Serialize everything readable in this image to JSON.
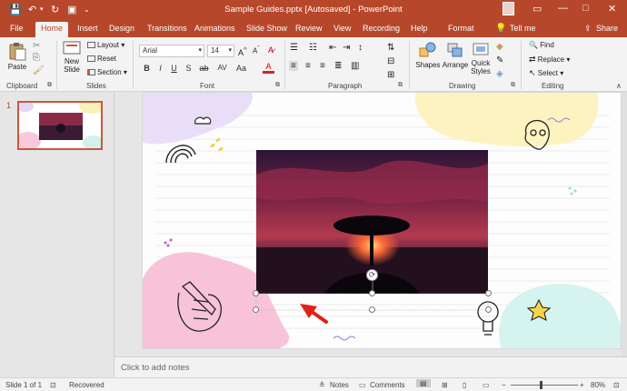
{
  "window": {
    "title": "Sample Guides.pptx [Autosaved] - PowerPoint",
    "account": "",
    "controls": [
      "—",
      "□",
      "✕"
    ]
  },
  "tabs": [
    {
      "label": "File"
    },
    {
      "label": "Home"
    },
    {
      "label": "Insert"
    },
    {
      "label": "Design"
    },
    {
      "label": "Transitions"
    },
    {
      "label": "Animations"
    },
    {
      "label": "Slide Show"
    },
    {
      "label": "Review"
    },
    {
      "label": "View"
    },
    {
      "label": "Recording"
    },
    {
      "label": "Help"
    },
    {
      "label": "Format"
    },
    {
      "label": "Tell me"
    },
    {
      "label": "Share"
    }
  ],
  "ribbon": {
    "clipboard": {
      "paste": "Paste",
      "label": "Clipboard"
    },
    "slides": {
      "new_slide": "New Slide",
      "layout": "Layout",
      "reset": "Reset",
      "section": "Section",
      "label": "Slides"
    },
    "font": {
      "name": "Arial",
      "size": "14",
      "label": "Font",
      "bold": "B",
      "italic": "I",
      "underline": "U",
      "strike": "S",
      "shadow": "ab",
      "spacing": "AV",
      "case": "Aa"
    },
    "paragraph": {
      "label": "Paragraph"
    },
    "drawing": {
      "shapes": "Shapes",
      "arrange": "Arrange",
      "quick_styles": "Quick Styles",
      "label": "Drawing"
    },
    "editing": {
      "find": "Find",
      "replace": "Replace",
      "select": "Select",
      "label": "Editing"
    }
  },
  "thumbnail": {
    "number": "1"
  },
  "notes": {
    "placeholder": "Click to add notes"
  },
  "status": {
    "slide": "Slide 1 of 1",
    "recovered": "Recovered",
    "notes": "Notes",
    "comments": "Comments",
    "zoom": "80%",
    "zoom_level": 0.8
  },
  "colors": {
    "accent": "#b7472a",
    "arrow": "#e0201a"
  }
}
